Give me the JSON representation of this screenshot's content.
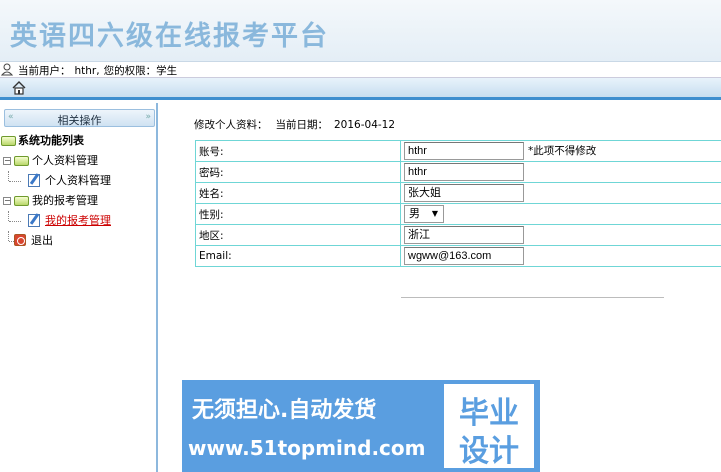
{
  "header": {
    "title": "英语四六级在线报考平台"
  },
  "userbar": {
    "current_user_label": "当前用户：",
    "username": "hthr,",
    "role_text": "您的权限：学生"
  },
  "nav": {
    "home_icon": "home-icon"
  },
  "sidebar": {
    "header_label": "相关操作",
    "tree": {
      "root_label": "系统功能列表",
      "groups": [
        {
          "label": "个人资料管理",
          "children": [
            "个人资料管理"
          ]
        },
        {
          "label": "我的报考管理",
          "children": [
            "我的报考管理"
          ]
        }
      ],
      "exit_label": "退出"
    }
  },
  "content": {
    "breadcrumb_label": "修改个人资料：",
    "date_label": "当前日期：",
    "date_value": "2016-04-12",
    "form": {
      "account_label": "账号:",
      "account_value": "hthr",
      "account_note": "*此项不得修改",
      "password_label": "密码:",
      "password_value": "hthr",
      "name_label": "姓名:",
      "name_value": "张大姐",
      "gender_label": "性别:",
      "gender_value": "男",
      "region_label": "地区:",
      "region_value": "浙江",
      "email_label": "Email:",
      "email_value": "wgww@163.com"
    }
  },
  "banner": {
    "line1": "无须担心.自动发货",
    "line2": "www.51topmind.com",
    "box_line1": "毕业",
    "box_line2": "设计"
  },
  "colors": {
    "title": "#8ab8dc",
    "nav_accent": "#3f8fcf",
    "table_border": "#6fd6d6",
    "active_link": "#cc0000",
    "banner_bg": "#5a9ee0"
  }
}
